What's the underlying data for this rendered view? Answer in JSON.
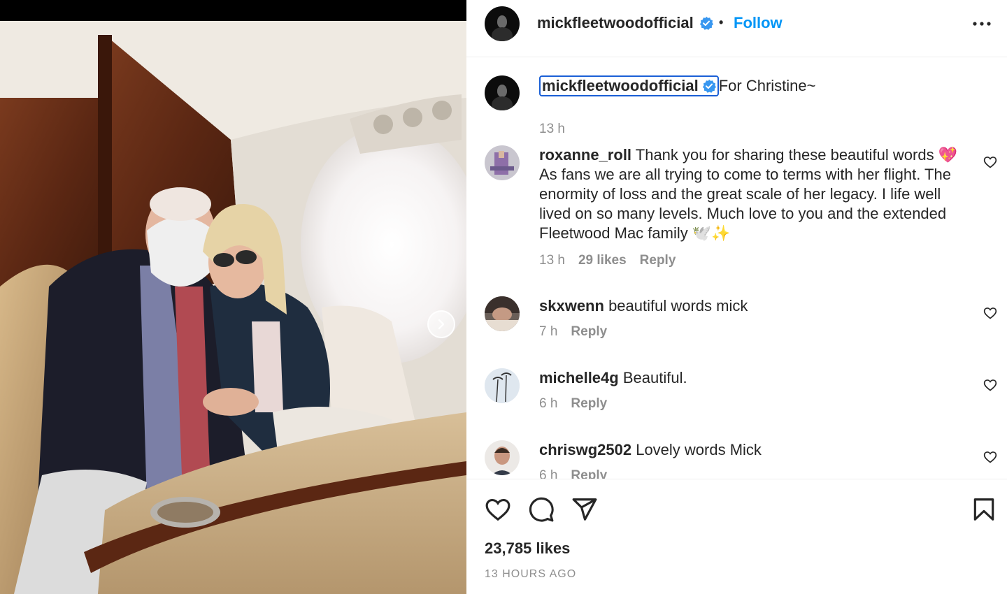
{
  "post": {
    "username": "mickfleetwoodofficial",
    "follow_label": "Follow",
    "dot": "•",
    "caption": "For Christine~",
    "caption_time": "13 h",
    "likes": "23,785 likes",
    "time_ago": "13 HOURS AGO"
  },
  "comments": [
    {
      "user": "roxanne_roll",
      "text": "Thank you for sharing these beautiful words 💖 As fans we are all trying to come to terms with her flight. The enormity of loss and the great scale of her legacy. I life well lived on so many levels. Much love to you and the extended Fleetwood Mac family 🕊️✨",
      "time": "13 h",
      "likes": "29 likes",
      "reply": "Reply"
    },
    {
      "user": "skxwenn",
      "text": "beautiful words mick",
      "time": "7 h",
      "reply": "Reply"
    },
    {
      "user": "michelle4g",
      "text": "Beautiful.",
      "time": "6 h",
      "reply": "Reply"
    },
    {
      "user": "chriswg2502",
      "text": "Lovely words Mick",
      "time": "6 h",
      "reply": "Reply"
    }
  ],
  "colors": {
    "link_blue": "#0095f6",
    "verified_blue": "#3897f0",
    "muted_gray": "#8e8e8e",
    "text": "#262626"
  },
  "icons": [
    "verified-badge-icon",
    "more-options-icon",
    "heart-icon",
    "comment-icon",
    "share-icon",
    "bookmark-icon",
    "chevron-right-icon"
  ]
}
